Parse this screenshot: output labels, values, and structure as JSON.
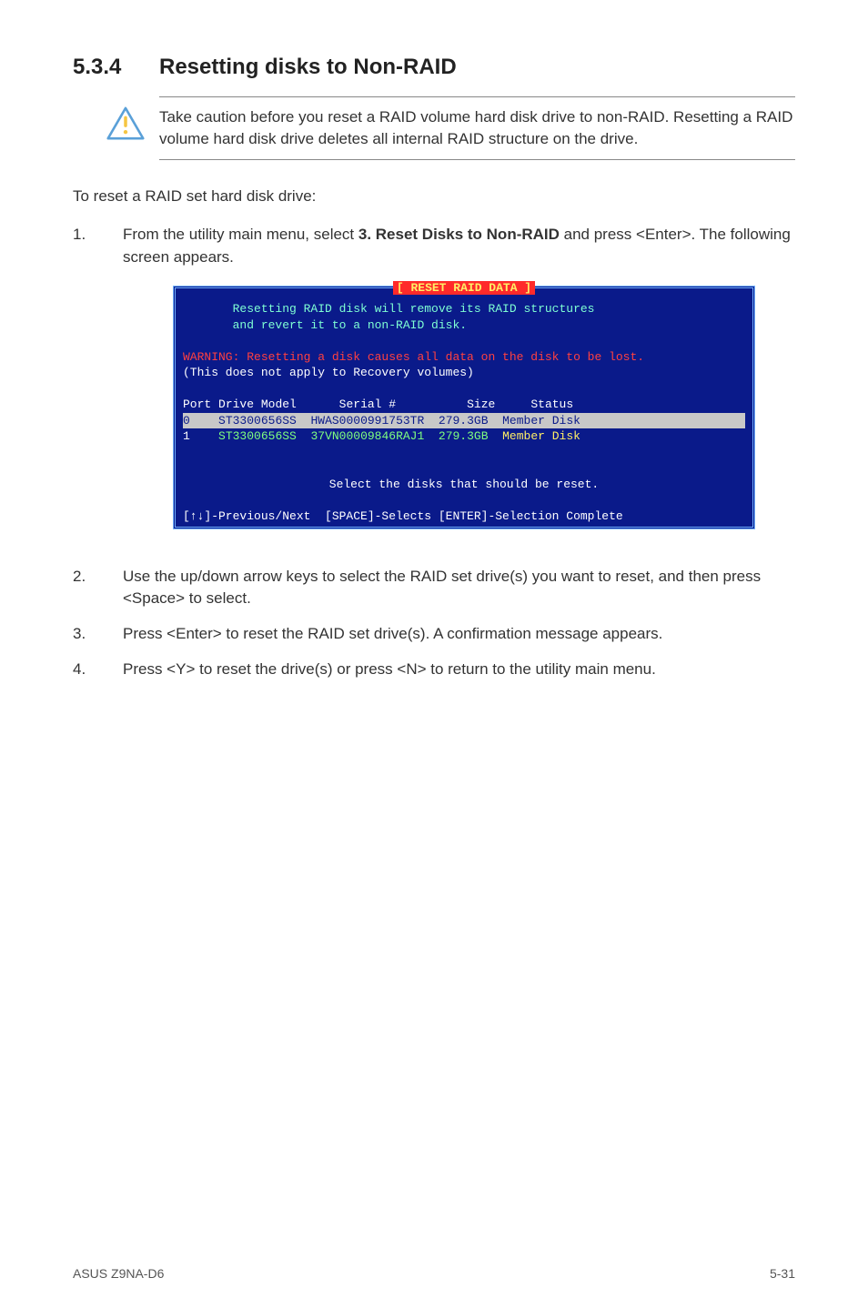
{
  "heading": {
    "number": "5.3.4",
    "title": "Resetting disks to Non-RAID"
  },
  "callout": "Take caution before you reset a RAID volume hard disk drive to non-RAID. Resetting a RAID volume hard disk drive deletes all internal RAID structure on the drive.",
  "intro": "To reset a RAID set hard disk drive:",
  "steps": {
    "s1_pre": "From the utility main menu, select ",
    "s1_bold": "3. Reset Disks to Non-RAID",
    "s1_post": " and press <Enter>. The following screen appears.",
    "s2": "Use the up/down arrow keys to select the RAID set drive(s) you want to reset, and then press <Space> to select.",
    "s3": "Press <Enter> to reset the RAID set drive(s). A confirmation message appears.",
    "s4": "Press <Y> to reset the drive(s) or press <N> to return to the utility main menu."
  },
  "terminal": {
    "title": "[ RESET RAID DATA ]",
    "msg1": "Resetting RAID disk will remove its RAID structures",
    "msg2": "and revert it to a non-RAID disk.",
    "warn": "WARNING: Resetting a disk causes all data on the disk to be lost.",
    "recov": "(This does not apply to Recovery volumes)",
    "header": {
      "port": "Port",
      "drive": "Drive Model",
      "serial": "Serial #",
      "size": "Size",
      "status": "Status"
    },
    "rows": [
      {
        "port": "0",
        "model": "ST3300656SS",
        "serial": "HWAS0000991753TR",
        "size": "279.3GB",
        "status": "Member Disk"
      },
      {
        "port": "1",
        "model": "ST3300656SS",
        "serial": "37VN00009846RAJ1",
        "size": "279.3GB",
        "status": "Member Disk"
      }
    ],
    "select_msg": "Select the disks that should be reset.",
    "footer": "[↑↓]-Previous/Next  [SPACE]-Selects [ENTER]-Selection Complete"
  },
  "footer": {
    "left": "ASUS Z9NA-D6",
    "right": "5-31"
  }
}
